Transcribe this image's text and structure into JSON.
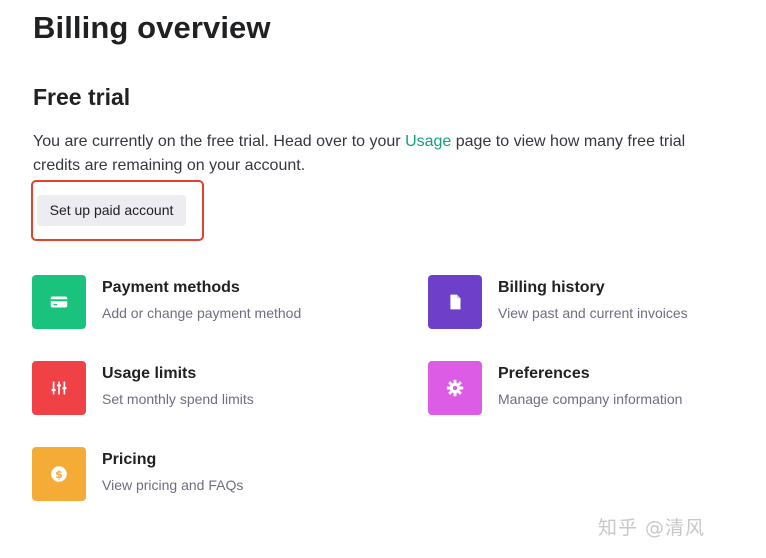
{
  "page": {
    "title": "Billing overview"
  },
  "trial": {
    "heading": "Free trial",
    "text_before_link": "You are currently on the free trial. Head over to your ",
    "link_text": "Usage",
    "text_after_link": " page to view how many free trial credits are remaining on your account.",
    "setup_button_label": "Set up paid account"
  },
  "cards": {
    "payment_methods": {
      "title": "Payment methods",
      "description": "Add or change payment method",
      "icon": "credit-card-icon",
      "color": "#19c37d"
    },
    "billing_history": {
      "title": "Billing history",
      "description": "View past and current invoices",
      "icon": "document-icon",
      "color": "#6e40c9"
    },
    "usage_limits": {
      "title": "Usage limits",
      "description": "Set monthly spend limits",
      "icon": "sliders-icon",
      "color": "#ef4146"
    },
    "preferences": {
      "title": "Preferences",
      "description": "Manage company information",
      "icon": "gear-icon",
      "color": "#dd5ce5"
    },
    "pricing": {
      "title": "Pricing",
      "description": "View pricing and FAQs",
      "icon": "dollar-icon",
      "color": "#f4ac36"
    }
  },
  "watermark": {
    "text": "知乎 @清风"
  },
  "colors": {
    "accent_link": "#10a37f",
    "highlight_border": "#e2432a",
    "button_bg": "#ececf1"
  }
}
